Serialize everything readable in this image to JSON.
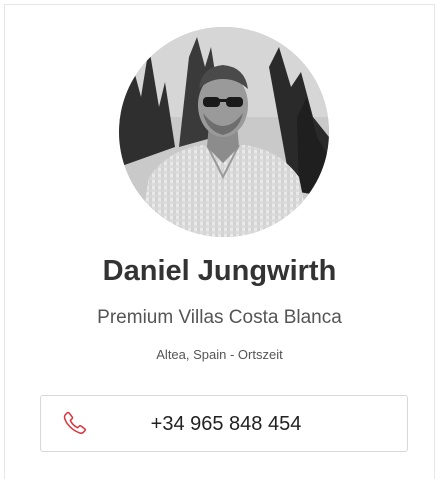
{
  "profile": {
    "name": "Daniel Jungwirth",
    "company": "Premium Villas Costa Blanca",
    "location": "Altea, Spain - Ortszeit",
    "avatar_icon": "profile-photo"
  },
  "contact": {
    "phone": "+34 965 848 454",
    "phone_icon": "phone-icon",
    "accent_color": "#d9363e"
  }
}
